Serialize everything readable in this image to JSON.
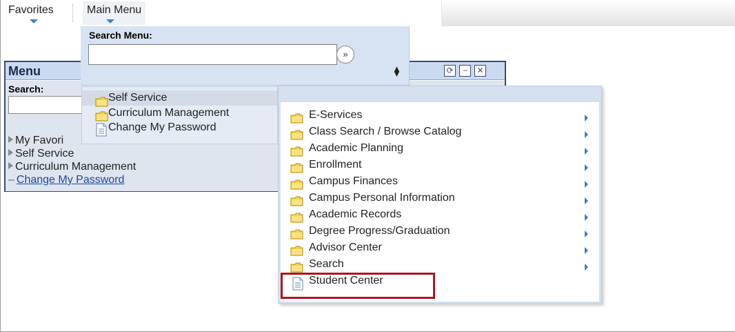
{
  "topnav": {
    "favorites": "Favorites",
    "main_menu": "Main Menu"
  },
  "menu_pagelet": {
    "title": "Menu",
    "search_label": "Search:",
    "tree": {
      "my_favorites": "My Favori",
      "self_service": "Self Service",
      "curriculum": "Curriculum Management",
      "change_password": "Change My Password"
    }
  },
  "search_menu": {
    "label": "Search Menu:",
    "go_symbol": "»"
  },
  "flyout1": {
    "items": [
      "Self Service",
      "Curriculum Management",
      "Change My Password"
    ]
  },
  "flyout2": {
    "items": [
      "E-Services",
      "Class Search / Browse Catalog",
      "Academic Planning",
      "Enrollment",
      "Campus Finances",
      "Campus Personal Information",
      "Academic Records",
      "Degree Progress/Graduation",
      "Advisor Center",
      "Search",
      "Student Center"
    ]
  },
  "colors": {
    "highlight_box": "#b0141c",
    "link": "#1a47a3",
    "folder": "#f6d44a",
    "submenu_arrow": "#3a7cc4"
  }
}
